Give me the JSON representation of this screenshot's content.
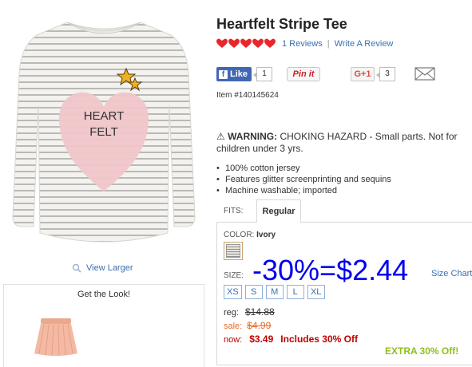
{
  "product": {
    "title": "Heartfelt Stripe Tee",
    "rating_hearts": 5,
    "reviews_link": "1 Reviews",
    "separator": "|",
    "write_review_link": "Write A Review",
    "item_number": "Item #140145624",
    "view_larger": "View Larger",
    "shirt_print_text_1": "HEART",
    "shirt_print_text_2": "FELT"
  },
  "social": {
    "fb_icon": "f",
    "fb_label": "Like",
    "fb_count": "1",
    "pinterest_label": "Pin it",
    "gplus_label": "G+1",
    "gplus_count": "3",
    "mail_icon": "envelope-icon"
  },
  "warning": {
    "icon": "⚠",
    "label": "WARNING:",
    "text": "CHOKING HAZARD - Small parts. Not for children under 3 yrs."
  },
  "features": [
    "100% cotton jersey",
    "Features glitter screenprinting and sequins",
    "Machine washable; imported"
  ],
  "fits": {
    "label": "FITS:",
    "selected": "Regular"
  },
  "options": {
    "color_label": "COLOR:",
    "color_value": "Ivory",
    "size_label": "SIZE:",
    "size_chart_link": "Size Chart",
    "sizes": [
      "XS",
      "S",
      "M",
      "L",
      "XL"
    ]
  },
  "pricing": {
    "reg_label": "reg:",
    "reg_value": "$14.88",
    "sale_label": "sale:",
    "sale_value": "$4.99",
    "now_label": "now:",
    "now_value": "$3.49",
    "now_note": "Includes 30% Off",
    "extra_badge": "EXTRA 30% Off!"
  },
  "overlay": {
    "text": "-30%=$2.44"
  },
  "get_the_look": {
    "title": "Get the Look!"
  },
  "colors": {
    "link": "#3a6fb0",
    "heart": "#e8262c",
    "sale": "#e36c2b",
    "now": "#c00000",
    "extra": "#8fbf1f",
    "overlay": "#0000ee"
  }
}
